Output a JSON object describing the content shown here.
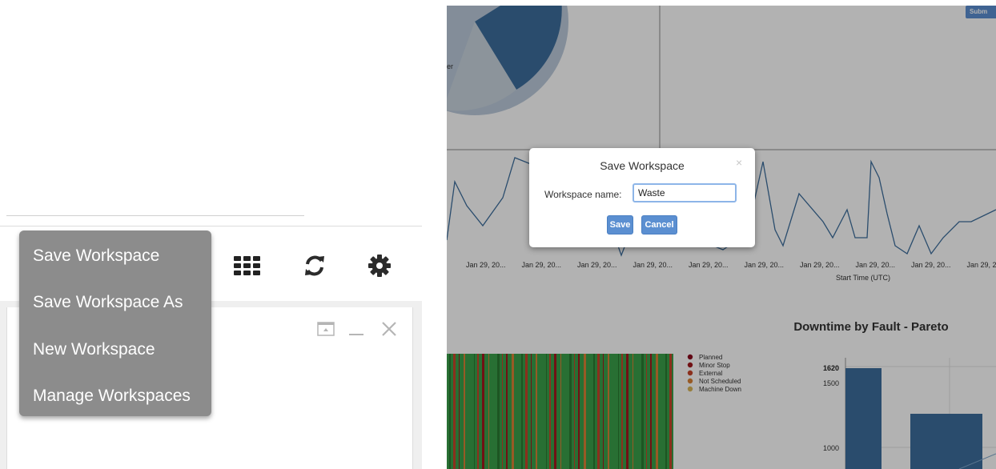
{
  "menu": {
    "items": [
      "Save Workspace",
      "Save Workspace As",
      "New Workspace",
      "Manage Workspaces"
    ]
  },
  "toolbar": {
    "icons": [
      "grid-icon",
      "refresh-icon",
      "gear-icon"
    ]
  },
  "panel_controls": [
    "restore-icon",
    "minimize-icon",
    "close-icon"
  ],
  "dashboard": {
    "submit_label": "Subm",
    "pie_partial_label": "er",
    "line_chart": {
      "x_tick_labels": [
        "Jan 29, 20...",
        "Jan 29, 20...",
        "Jan 29, 20...",
        "Jan 29, 20...",
        "Jan 29, 20...",
        "Jan 29, 20...",
        "Jan 29, 20...",
        "Jan 29, 20...",
        "Jan 29, 20...",
        "Jan 29, 2"
      ],
      "xlabel": "Start Time (UTC)"
    },
    "legend": {
      "items": [
        {
          "label": "Planned",
          "color": "#8b0a1e"
        },
        {
          "label": "Minor Stop",
          "color": "#a3191d"
        },
        {
          "label": "External",
          "color": "#c8452a"
        },
        {
          "label": "Not Scheduled",
          "color": "#d98236"
        },
        {
          "label": "Machine Down",
          "color": "#d9b55a"
        }
      ]
    },
    "pareto": {
      "title": "Downtime by Fault - Pareto",
      "y_tick_labels": [
        "1500",
        "1000"
      ],
      "max_label": "1620"
    }
  },
  "modal": {
    "title": "Save Workspace",
    "close_glyph": "×",
    "name_label": "Workspace name:",
    "name_value": "Waste",
    "save_label": "Save",
    "cancel_label": "Cancel"
  },
  "colors": {
    "menu_bg": "#8c8c8c",
    "primary": "#5b8fd1",
    "chart_blue": "#3d6e9c",
    "overlay": "rgba(0,0,0,0.30)"
  }
}
